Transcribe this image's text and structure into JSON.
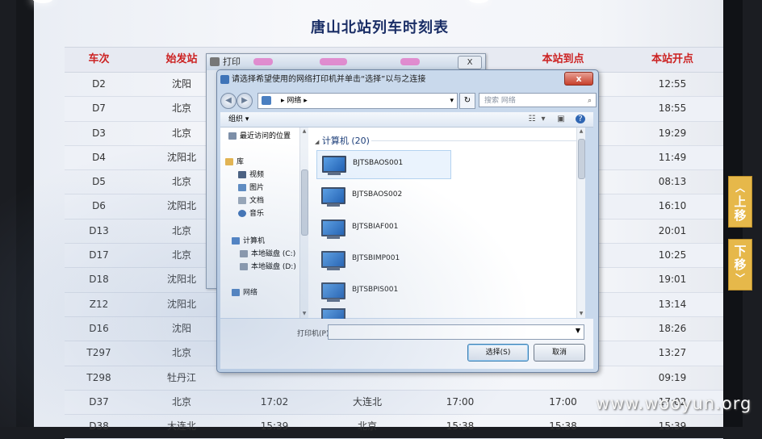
{
  "page": {
    "title": "唐山北站列车时刻表",
    "watermark": "www.wooyun.org"
  },
  "timetable": {
    "headers": [
      "车次",
      "始发站",
      "",
      "",
      "",
      "本站到点",
      "本站开点"
    ],
    "rows": [
      [
        "D2",
        "沈阳",
        "",
        "",
        "",
        "",
        "12:55"
      ],
      [
        "D7",
        "北京",
        "",
        "",
        "",
        "",
        "18:55"
      ],
      [
        "D3",
        "北京",
        "",
        "",
        "",
        "",
        "19:29"
      ],
      [
        "D4",
        "沈阳北",
        "",
        "",
        "",
        "",
        "11:49"
      ],
      [
        "D5",
        "北京",
        "",
        "",
        "",
        "",
        "08:13"
      ],
      [
        "D6",
        "沈阳北",
        "",
        "",
        "",
        "",
        "16:10"
      ],
      [
        "D13",
        "北京",
        "",
        "",
        "",
        "",
        "20:01"
      ],
      [
        "D17",
        "北京",
        "",
        "",
        "",
        "",
        "10:25"
      ],
      [
        "D18",
        "沈阳北",
        "",
        "",
        "",
        "",
        "19:01"
      ],
      [
        "Z12",
        "沈阳北",
        "",
        "",
        "",
        "",
        "13:14"
      ],
      [
        "D16",
        "沈阳",
        "",
        "",
        "",
        "",
        "18:26"
      ],
      [
        "T297",
        "北京",
        "",
        "",
        "",
        "",
        "13:27"
      ],
      [
        "T298",
        "牡丹江",
        "",
        "",
        "",
        "",
        "09:19"
      ],
      [
        "D37",
        "北京",
        "17:02",
        "大连北",
        "17:00",
        "17:00",
        "17:02"
      ],
      [
        "D38",
        "大连北",
        "15:39",
        "北京",
        "15:38",
        "15:38",
        "15:39"
      ]
    ]
  },
  "side_buttons": {
    "up": {
      "arrow": "︿",
      "l1": "上",
      "l2": "移"
    },
    "down": {
      "arrow": "﹀",
      "l1": "下",
      "l2": "移"
    }
  },
  "print_dialog": {
    "title": "打印",
    "close_label": "X"
  },
  "dialog": {
    "title": "请选择希望使用的网络打印机并单击“选择”以与之连接",
    "close_label": "x",
    "address": {
      "path": "网络",
      "sep": "▸",
      "dropdown": "▾"
    },
    "refresh_label": "↻",
    "search_placeholder": "搜索 网络",
    "toolbar": {
      "organize": "组织 ▾"
    },
    "nav": {
      "recent": "最近访问的位置",
      "libraries": "库",
      "videos": "视频",
      "pictures": "图片",
      "documents": "文档",
      "music": "音乐",
      "computer": "计算机",
      "drive_c": "本地磁盘 (C:)",
      "drive_d": "本地磁盘 (D:)",
      "network": "网络"
    },
    "group_header": "计算机 (20)",
    "group_toggle": "◢",
    "computers": [
      "BJTSBAOS001",
      "BJTSBAOS002",
      "BJTSBIAF001",
      "BJTSBIMP001",
      "BJTSBPIS001"
    ],
    "printer_label": "打印机(P):",
    "printer_value": "",
    "select_button": "选择(S)",
    "cancel_button": "取消"
  },
  "colors": {
    "header_red": "#cc2222",
    "title_blue": "#1a2e66",
    "side_button": "#e6b84a",
    "close_red": "#c7402b"
  }
}
